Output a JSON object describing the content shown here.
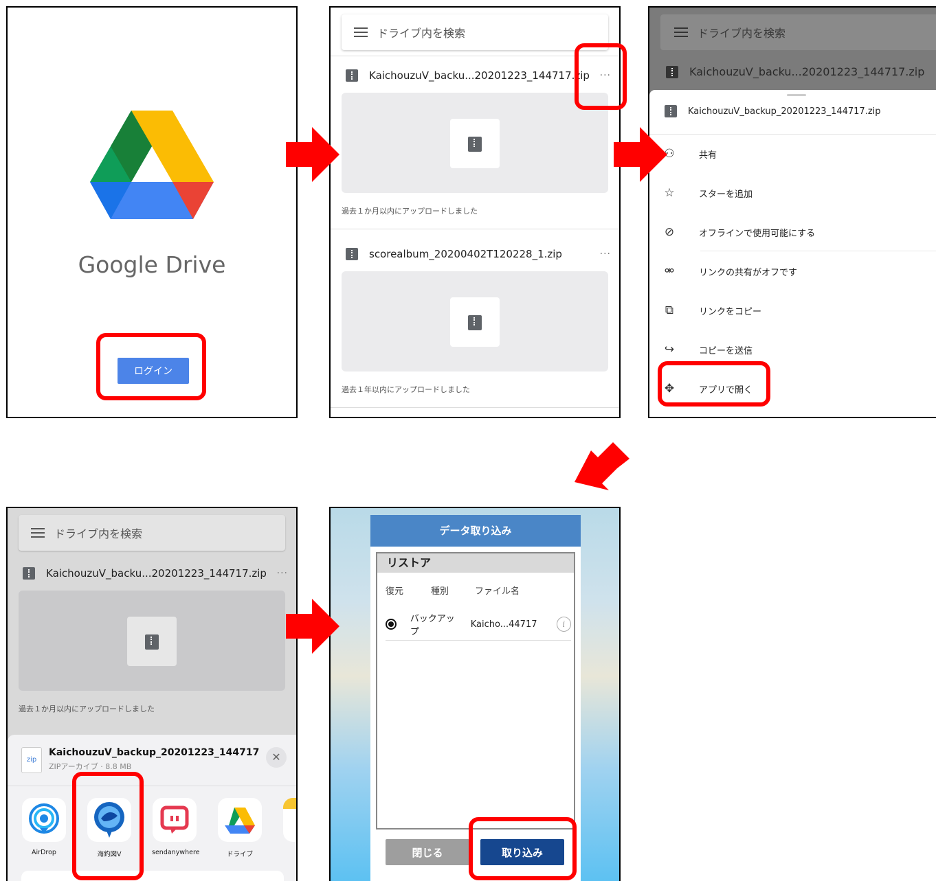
{
  "colors": {
    "highlight": "#ff0000",
    "drive_blue": "#4c84e8",
    "dialog_header": "#4a86c7",
    "import_button": "#16478f"
  },
  "panel1": {
    "title": "Google Drive",
    "login_label": "ログイン"
  },
  "panel2": {
    "search_placeholder": "ドライブ内を検索",
    "files": [
      {
        "name": "KaichouzuV_backu...20201223_144717.zip",
        "more": "···",
        "meta": "過去１か月以内にアップロードしました"
      },
      {
        "name": "scorealbum_20200402T120228_1.zip",
        "more": "···",
        "meta": "過去１年以内にアップロードしました"
      }
    ]
  },
  "panel3": {
    "search_placeholder": "ドライブ内を検索",
    "file_name": "KaichouzuV_backu...20201223_144717.zip",
    "more": "···",
    "sheet_file": "KaichouzuV_backup_20201223_144717.zip",
    "menu": [
      {
        "label": "共有",
        "icon": "add-person-icon"
      },
      {
        "label": "スターを追加",
        "icon": "star-icon"
      },
      {
        "label": "オフラインで使用可能にする",
        "icon": "offline-icon"
      },
      {
        "label": "リンクの共有がオフです",
        "icon": "link-off-icon"
      },
      {
        "label": "リンクをコピー",
        "icon": "copy-icon"
      },
      {
        "label": "コピーを送信",
        "icon": "send-icon"
      },
      {
        "label": "アプリで開く",
        "icon": "open-with-icon"
      }
    ]
  },
  "panel4": {
    "search_placeholder": "ドライブ内を検索",
    "file_name": "KaichouzuV_backu...20201223_144717.zip",
    "more": "···",
    "meta": "過去１か月以内にアップロードしました",
    "share_title": "KaichouzuV_backup_20201223_144717",
    "share_subtitle": "ZIPアーカイブ · 8.8 MB",
    "zip_label": "zip",
    "close_label": "✕",
    "apps": [
      {
        "label": "AirDrop",
        "icon": "airdrop-icon"
      },
      {
        "label": "海釣図V",
        "icon": "kaichouzu-icon"
      },
      {
        "label": "sendanywhere",
        "icon": "sendanywhere-icon"
      },
      {
        "label": "ドライブ",
        "icon": "drive-icon"
      }
    ]
  },
  "panel5": {
    "dialog_title": "データ取り込み",
    "section_title": "リストア",
    "columns": [
      "復元",
      "種別",
      "ファイル名"
    ],
    "row": {
      "type": "バックアップ",
      "file": "Kaicho...44717",
      "info": "i"
    },
    "close_label": "閉じる",
    "import_label": "取り込み"
  }
}
